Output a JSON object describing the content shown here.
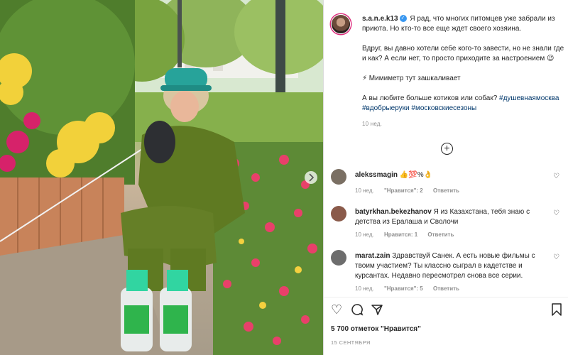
{
  "post": {
    "author": "s.a.n.e.k13",
    "caption_p1": "Я рад, что многих питомцев уже забрали из приюта. Но кто-то все еще ждет своего хозяина.",
    "caption_p2": "Вдруг, вы давно хотели себе кого-то завести, но не знали где и как? А если нет, то просто приходите за настроением 😉",
    "caption_p3": "⚡ Мимиметр тут зашкаливает",
    "caption_p4": "А вы любите больше котиков или собак?",
    "hashtags": [
      "#душевнаямосква",
      "#вдобрыеруки",
      "#московскиесезоны"
    ],
    "time": "10 нед."
  },
  "comments": [
    {
      "user": "alekssmagin",
      "text": "👍💯%👌",
      "time": "10 нед.",
      "likes": "\"Нравится\": 2",
      "reply": "Ответить",
      "avatar_color": "#7a6f63"
    },
    {
      "user": "batyrkhan.bekezhanov",
      "text": "Я из Казахстана, тебя знаю с детства из Ералаша и Сволочи",
      "time": "10 нед.",
      "likes": "Нравится: 1",
      "reply": "Ответить",
      "avatar_color": "#8a5a4a"
    },
    {
      "user": "marat.zain",
      "text": "Здравствуй Санек. А есть новые фильмы с твоим участием? Ты классно сыграл в кадетстве и курсантах. Недавно пересмотрел снова все серии.",
      "time": "10 нед.",
      "likes": "\"Нравится\": 5",
      "reply": "Ответить",
      "avatar_color": "#6d6d6d"
    }
  ],
  "likes_count": "5 700 отметок \"Нравится\"",
  "date": "15 СЕНТЯБРЯ",
  "icons": {
    "more": "plus-circle-icon",
    "comment_like": "heart-outline-icon",
    "like": "heart-icon",
    "comment": "comment-bubble-icon",
    "share": "paper-plane-icon",
    "save": "bookmark-icon"
  },
  "colors": {
    "hashtag": "#00376b",
    "verified": "#3897f0",
    "muted": "#8e8e8e"
  }
}
